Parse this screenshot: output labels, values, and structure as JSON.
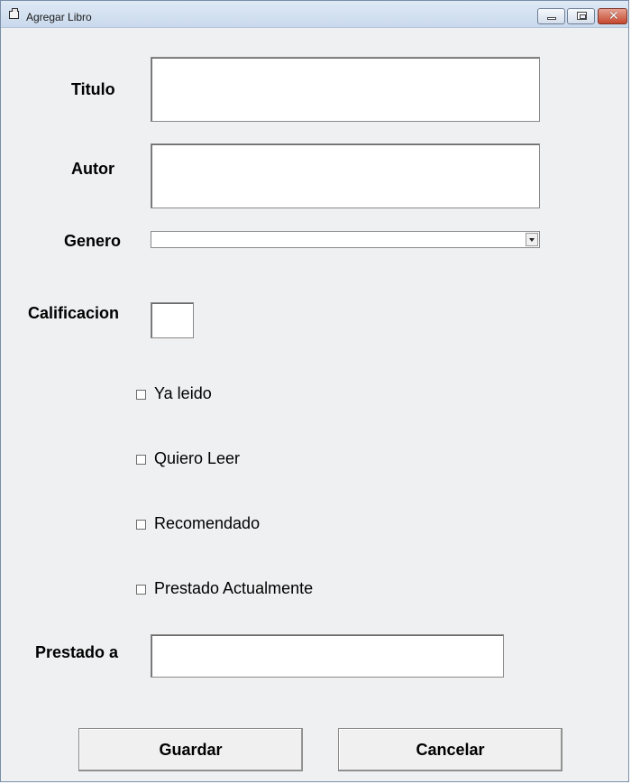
{
  "window": {
    "title": "Agregar Libro"
  },
  "form": {
    "titulo": {
      "label": "Titulo",
      "value": ""
    },
    "autor": {
      "label": "Autor",
      "value": ""
    },
    "genero": {
      "label": "Genero",
      "value": ""
    },
    "calificacion": {
      "label": "Calificacion",
      "value": ""
    },
    "checkboxes": [
      {
        "label": "Ya leido",
        "checked": false
      },
      {
        "label": "Quiero Leer",
        "checked": false
      },
      {
        "label": "Recomendado",
        "checked": false
      },
      {
        "label": "Prestado Actualmente",
        "checked": false
      }
    ],
    "prestado_a": {
      "label": "Prestado a",
      "value": ""
    }
  },
  "buttons": {
    "guardar": "Guardar",
    "cancelar": "Cancelar"
  },
  "colors": {
    "form_background": "#eff0f1",
    "close_button": "#c6472d"
  }
}
